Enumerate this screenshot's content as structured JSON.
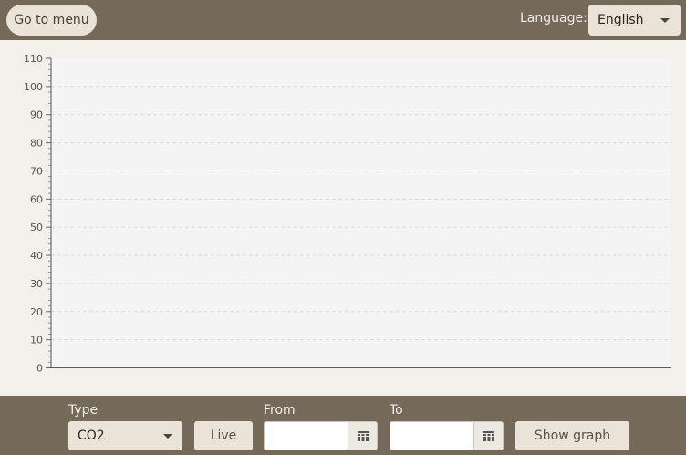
{
  "header": {
    "menu_button_label": "Go to menu",
    "language_label": "Language:",
    "language_value": "English"
  },
  "chart_data": {
    "type": "line",
    "title": "",
    "xlabel": "",
    "ylabel": "",
    "ylim": [
      0,
      110
    ],
    "y_ticks": [
      0,
      10,
      20,
      30,
      40,
      50,
      60,
      70,
      80,
      90,
      100,
      110
    ],
    "grid": true,
    "series": []
  },
  "controls": {
    "type_label": "Type",
    "type_value": "CO2",
    "live_label": "Live",
    "from_label": "From",
    "from_value": "",
    "to_label": "To",
    "to_value": "",
    "show_graph_label": "Show graph"
  },
  "colors": {
    "bar_background": "#75695a",
    "page_background": "#f3efea",
    "plot_background": "#f4f4f4",
    "button_background": "#ece3d8",
    "grid_line": "#dcdcdc",
    "axis_line": "#555555"
  },
  "icons": {
    "calendar": "calendar-icon",
    "dropdown": "chevron-down-icon"
  }
}
